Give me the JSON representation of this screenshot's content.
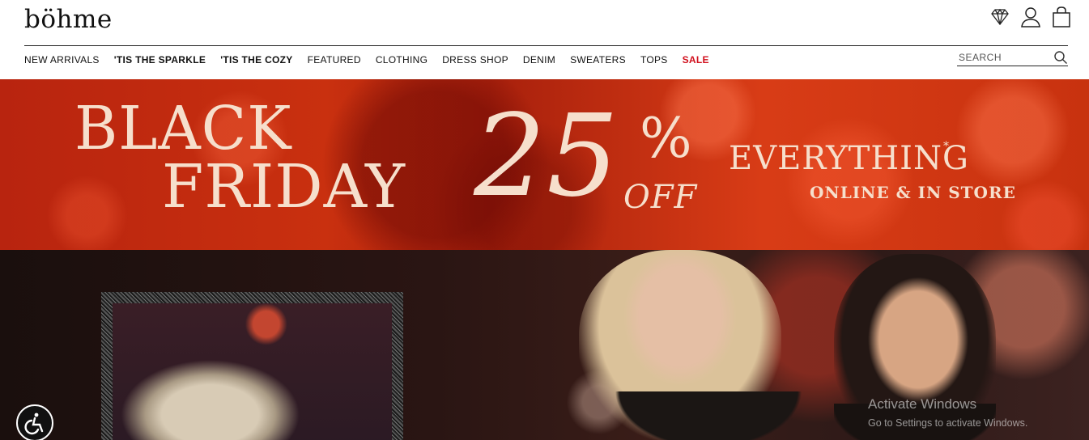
{
  "header": {
    "logo": "böhme",
    "icons": [
      "diamond-icon",
      "account-icon",
      "cart-icon"
    ]
  },
  "nav": {
    "items": [
      {
        "label": "NEW ARRIVALS"
      },
      {
        "label": "'TIS THE SPARKLE"
      },
      {
        "label": "'TIS THE COZY"
      },
      {
        "label": "FEATURED"
      },
      {
        "label": "CLOTHING"
      },
      {
        "label": "DRESS SHOP"
      },
      {
        "label": "DENIM"
      },
      {
        "label": "SWEATERS"
      },
      {
        "label": "TOPS"
      },
      {
        "label": "SALE"
      }
    ],
    "sale_color": "#d10f1c"
  },
  "search": {
    "placeholder": "SEARCH",
    "value": ""
  },
  "banner": {
    "line1": "BLACK",
    "line2": "FRIDAY",
    "discount": "25",
    "percent": "%",
    "off": "OFF",
    "everything": "EVERYTHING",
    "asterisk": "*",
    "where": "ONLINE & IN STORE",
    "background_color": "#c9300f",
    "text_color": "#f6dfcc"
  },
  "overlay": {
    "activate_title": "Activate Windows",
    "activate_sub": "Go to Settings to activate Windows."
  },
  "accessibility": {
    "icon": "wheelchair-icon"
  }
}
